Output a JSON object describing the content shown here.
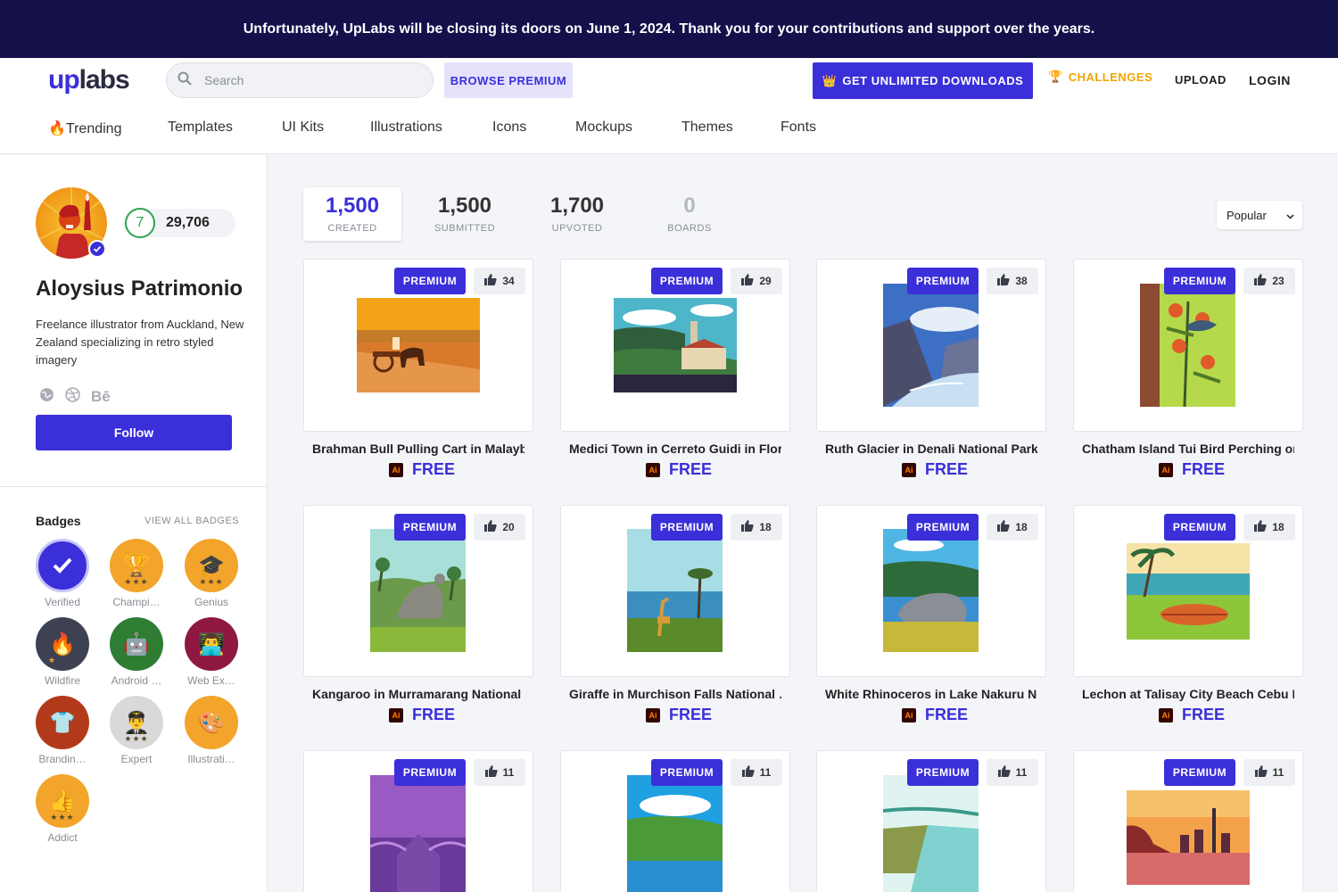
{
  "banner": {
    "text": "Unfortunately, UpLabs will be closing its doors on June 1, 2024. Thank you for your contributions and support over the years."
  },
  "header": {
    "logo_up": "up",
    "logo_labs": "labs",
    "search_placeholder": "Search",
    "browse_premium": "BROWSE PREMIUM",
    "unlimited": "GET UNLIMITED DOWNLOADS",
    "challenges": "CHALLENGES",
    "upload": "UPLOAD",
    "login": "LOGIN",
    "accent": "#3b2fd9"
  },
  "categories": [
    "🔥Trending",
    "Templates",
    "UI Kits",
    "Illustrations",
    "Icons",
    "Mockups",
    "Themes",
    "Fonts"
  ],
  "profile": {
    "level": "7",
    "points": "29,706",
    "name": "Aloysius Patrimonio",
    "bio": "Freelance illustrator from Auckland, New Zealand specializing in retro styled imagery",
    "behance": "Bē",
    "follow": "Follow"
  },
  "badges": {
    "title": "Badges",
    "view_all": "VIEW ALL BADGES",
    "items": [
      {
        "label": "Verified",
        "icon": "check-icon",
        "stars": ""
      },
      {
        "label": "Champi…",
        "icon": "trophy-icon",
        "stars": "★★★"
      },
      {
        "label": "Genius",
        "icon": "graduation-cap-icon",
        "stars": "★★★"
      },
      {
        "label": "Wildfire",
        "icon": "fire-icon",
        "stars": "★"
      },
      {
        "label": "Android …",
        "icon": "robot-icon",
        "stars": ""
      },
      {
        "label": "Web Ex…",
        "icon": "laptop-user-icon",
        "stars": ""
      },
      {
        "label": "Brandin…",
        "icon": "tshirt-icon",
        "stars": ""
      },
      {
        "label": "Expert",
        "icon": "pilot-icon",
        "stars": "★★★"
      },
      {
        "label": "Illustrati…",
        "icon": "palette-icon",
        "stars": ""
      },
      {
        "label": "Addict",
        "icon": "thumbs-up-icon",
        "stars": "★★★"
      }
    ]
  },
  "stats": [
    {
      "value": "1,500",
      "label": "CREATED"
    },
    {
      "value": "1,500",
      "label": "SUBMITTED"
    },
    {
      "value": "1,700",
      "label": "UPVOTED"
    },
    {
      "value": "0",
      "label": "BOARDS"
    }
  ],
  "sort": {
    "selected": "Popular"
  },
  "cards": [
    {
      "title": "Brahman Bull Pulling Cart in Malayb…",
      "likes": "34",
      "badge": "PREMIUM",
      "price": "FREE",
      "file": "Ai"
    },
    {
      "title": "Medici Town in Cerreto Guidi in Flor…",
      "likes": "29",
      "badge": "PREMIUM",
      "price": "FREE",
      "file": "Ai"
    },
    {
      "title": "Ruth Glacier in Denali National Park …",
      "likes": "38",
      "badge": "PREMIUM",
      "price": "FREE",
      "file": "Ai"
    },
    {
      "title": "Chatham Island Tui Bird Perching on…",
      "likes": "23",
      "badge": "PREMIUM",
      "price": "FREE",
      "file": "Ai"
    },
    {
      "title": "Kangaroo in Murramarang National …",
      "likes": "20",
      "badge": "PREMIUM",
      "price": "FREE",
      "file": "Ai"
    },
    {
      "title": "Giraffe in Murchison Falls National …",
      "likes": "18",
      "badge": "PREMIUM",
      "price": "FREE",
      "file": "Ai"
    },
    {
      "title": "White Rhinoceros in Lake Nakuru N…",
      "likes": "18",
      "badge": "PREMIUM",
      "price": "FREE",
      "file": "Ai"
    },
    {
      "title": "Lechon at Talisay City Beach Cebu P…",
      "likes": "18",
      "badge": "PREMIUM",
      "price": "FREE",
      "file": "Ai"
    },
    {
      "title": "",
      "likes": "11",
      "badge": "PREMIUM",
      "price": "",
      "file": ""
    },
    {
      "title": "",
      "likes": "11",
      "badge": "PREMIUM",
      "price": "",
      "file": ""
    },
    {
      "title": "",
      "likes": "11",
      "badge": "PREMIUM",
      "price": "",
      "file": ""
    },
    {
      "title": "",
      "likes": "11",
      "badge": "PREMIUM",
      "price": "",
      "file": ""
    }
  ]
}
